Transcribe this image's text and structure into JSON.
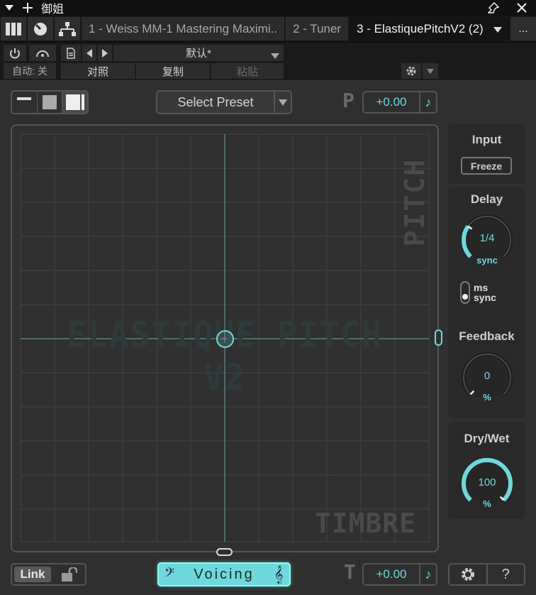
{
  "window": {
    "title": "御姐",
    "menu_icon": "triangle-down-icon",
    "add_icon": "plus-icon",
    "pin_icon": "pin-icon",
    "close_icon": "close-icon"
  },
  "tabs": [
    {
      "label": "1 - Weiss MM-1 Mastering Maximi.."
    },
    {
      "label": "2 - Tuner"
    },
    {
      "label": "3 - ElastiquePitchV2 (2)"
    }
  ],
  "tab_more": "...",
  "host_controls": {
    "preset_name": "默认*",
    "auto_label": "自动: 关",
    "compare_label": "对照",
    "copy_label": "复制",
    "paste_label": "粘贴"
  },
  "plugin": {
    "select_preset": "Select Preset",
    "pitch_letter": "P",
    "pitch_value": "+0.00",
    "timbre_letter": "T",
    "timbre_value": "+0.00",
    "pad_watermark": "ELASTIQUE PITCH V2",
    "pad_pitch_label": "PITCH",
    "pad_timbre_label": "TIMBRE",
    "input_title": "Input",
    "freeze_label": "Freeze",
    "delay_title": "Delay",
    "delay_value": "1/4",
    "delay_unit": "sync",
    "switch_ms": "ms",
    "switch_sync": "sync",
    "feedback_title": "Feedback",
    "feedback_value": "0",
    "feedback_unit": "%",
    "drywet_title": "Dry/Wet",
    "drywet_value": "100",
    "drywet_unit": "%",
    "link_label": "Link",
    "voicing_label": "Voicing",
    "help_label": "?",
    "note_symbol": "♪",
    "clef_bass": "𝄢",
    "clef_treble": "𝄞"
  },
  "colors": {
    "accent": "#6fd8dc",
    "panel": "#2f2f2f",
    "border": "#555555"
  },
  "levels": {
    "delay_fraction": 0.3,
    "feedback_fraction": 0.0,
    "drywet_fraction": 1.0
  }
}
